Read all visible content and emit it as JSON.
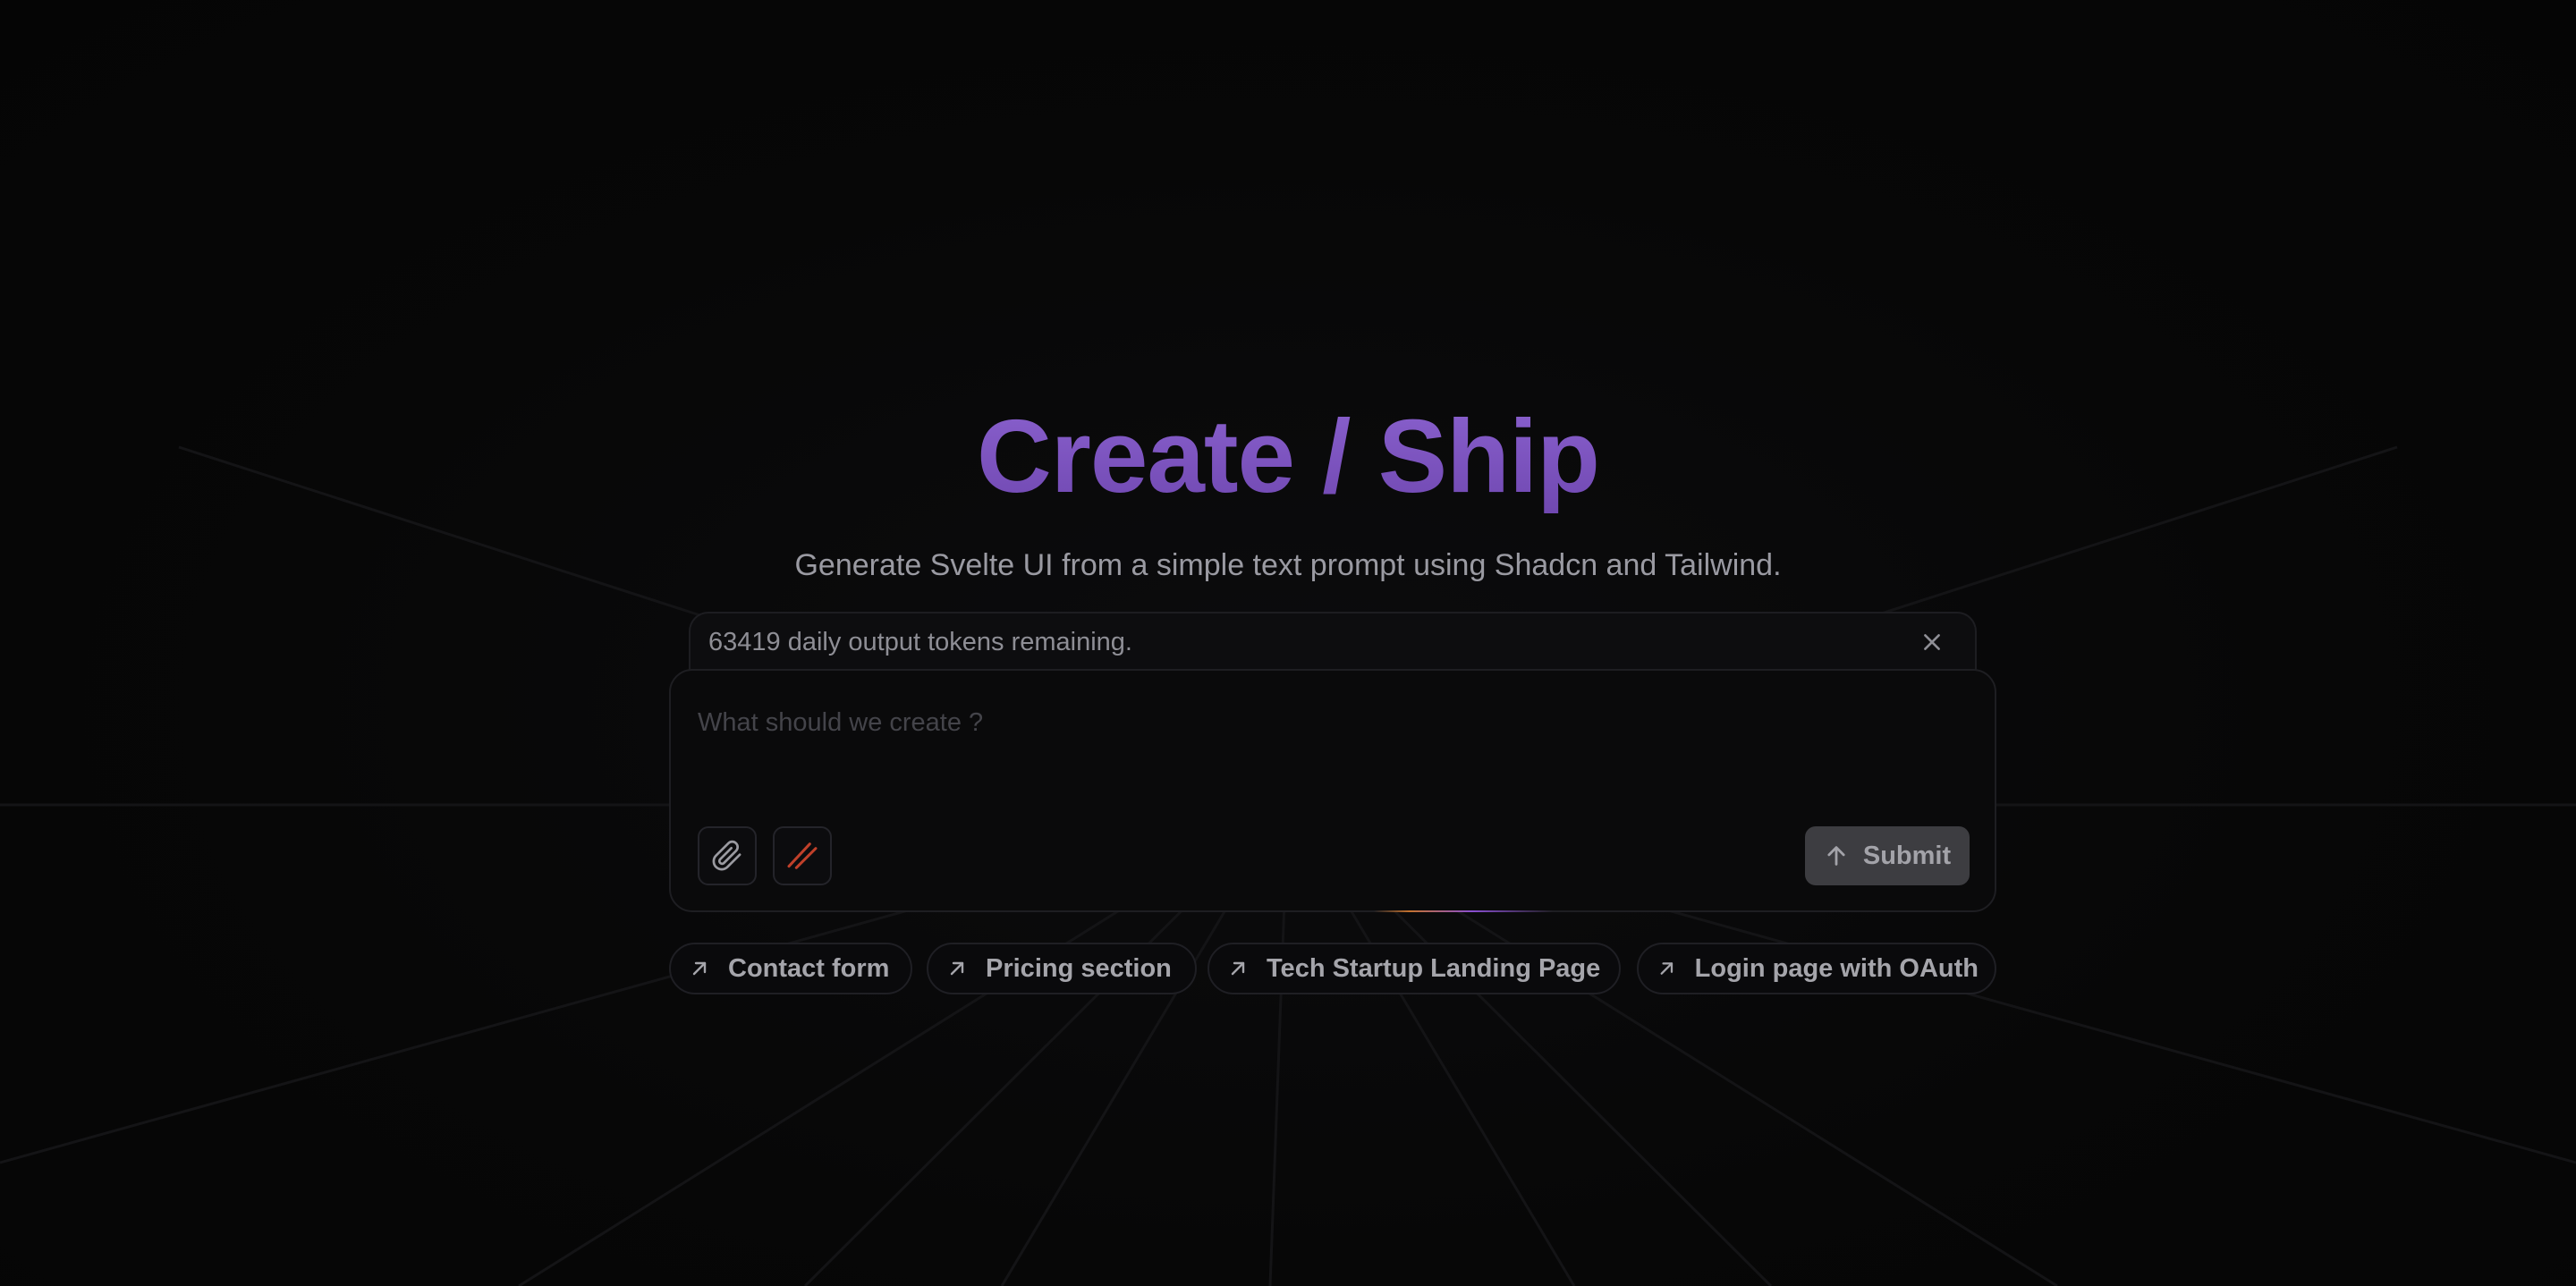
{
  "hero": {
    "title": "Create / Ship",
    "subtitle": "Generate Svelte UI from a simple text prompt using Shadcn and Tailwind."
  },
  "tokens": {
    "message": "63419 daily output tokens remaining."
  },
  "prompt": {
    "placeholder": "What should we create ?",
    "value": "",
    "submit_label": "Submit"
  },
  "icons": {
    "close": "close-icon",
    "attach": "paperclip-icon",
    "svelte": "svelte-icon",
    "submit": "arrow-up-icon",
    "suggestion": "arrow-up-right-icon"
  },
  "suggestions": [
    {
      "label": "Contact form"
    },
    {
      "label": "Pricing section"
    },
    {
      "label": "Tech Startup Landing Page"
    },
    {
      "label": "Login page with OAuth"
    }
  ],
  "colors": {
    "title_accent": "#7e56c0",
    "svelte_icon": "#c0402a",
    "background": "#060606"
  }
}
